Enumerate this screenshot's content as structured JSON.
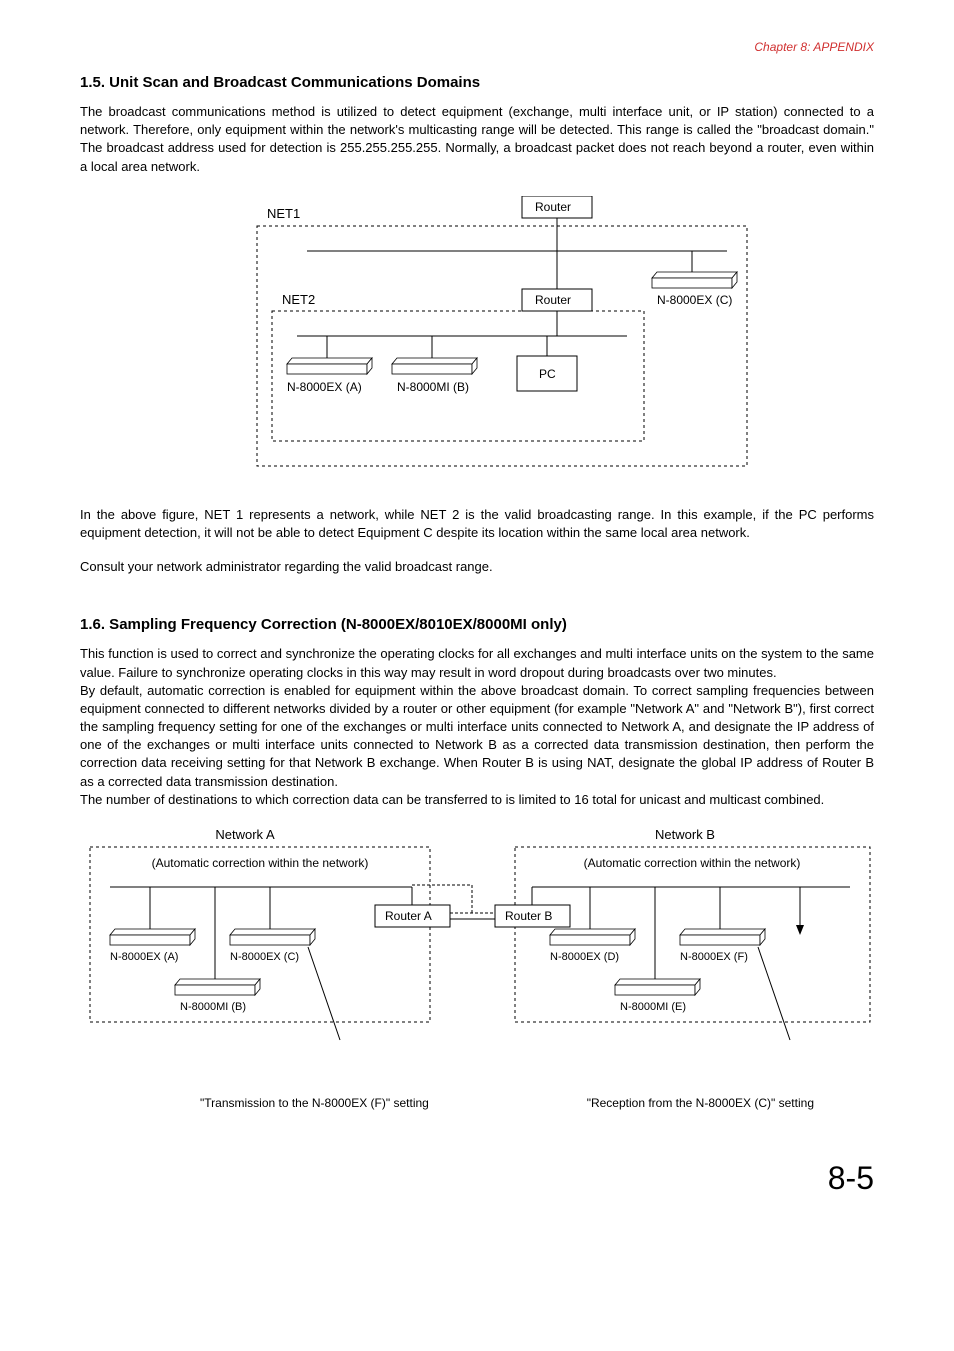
{
  "chapter_header": "Chapter 8:  APPENDIX",
  "section15": {
    "heading": "1.5. Unit Scan and Broadcast Communications Domains",
    "para1": "The broadcast communications method is utilized to detect equipment (exchange, multi interface unit, or IP station) connected to a network. Therefore, only equipment within the network's multicasting range will be detected. This range is called the \"broadcast domain.\" The broadcast address used for detection is 255.255.255.255. Normally, a broadcast packet does not reach beyond a router, even within a local area network.",
    "fig": {
      "net1": "NET1",
      "net2": "NET2",
      "router": "Router",
      "devA": "N-8000EX (A)",
      "devB": "N-8000MI (B)",
      "pc": "PC",
      "devC": "N-8000EX (C)"
    },
    "para2": "In the above figure, NET 1 represents a network, while NET 2 is the valid broadcasting range. In this example, if the PC performs equipment detection, it will not be able to detect Equipment C despite its location within the same local area network.",
    "para3": "Consult your network administrator regarding the valid broadcast range."
  },
  "section16": {
    "heading": "1.6. Sampling Frequency Correction (N-8000EX/8010EX/8000MI only)",
    "para1": "This function is used to correct and synchronize the operating clocks for all exchanges and multi interface units on the system to the same value. Failure to synchronize operating clocks in this way may result in word dropout during broadcasts over two minutes.",
    "para2": "By default, automatic correction is enabled for equipment within the above broadcast domain. To correct sampling frequencies between equipment connected to different networks divided by a router or other equipment (for example \"Network A\" and \"Network B\"), first correct the sampling frequency setting for one of the exchanges or multi interface units connected to Network A, and designate the IP address of one of the exchanges or multi interface units connected to Network B as a corrected data transmission destination, then perform the correction data receiving setting for that Network B exchange. When Router B is using NAT, designate the global IP address of Router B as a corrected data transmission destination.",
    "para3": "The number of destinations to which correction data can be transferred to is limited to 16 total for unicast and multicast combined.",
    "fig": {
      "netA": "Network A",
      "netB": "Network B",
      "autoA": "(Automatic correction within the network)",
      "autoB": "(Automatic correction within the network)",
      "routerA": "Router A",
      "routerB": "Router B",
      "devA": "N-8000EX (A)",
      "devB": "N-8000MI (B)",
      "devC": "N-8000EX (C)",
      "devD": "N-8000EX (D)",
      "devE": "N-8000MI (E)",
      "devF": "N-8000EX (F)",
      "captionLeft": "\"Transmission to the N-8000EX (F)\" setting",
      "captionRight": "\"Reception from the N-8000EX (C)\" setting"
    }
  },
  "page_number": "8-5"
}
